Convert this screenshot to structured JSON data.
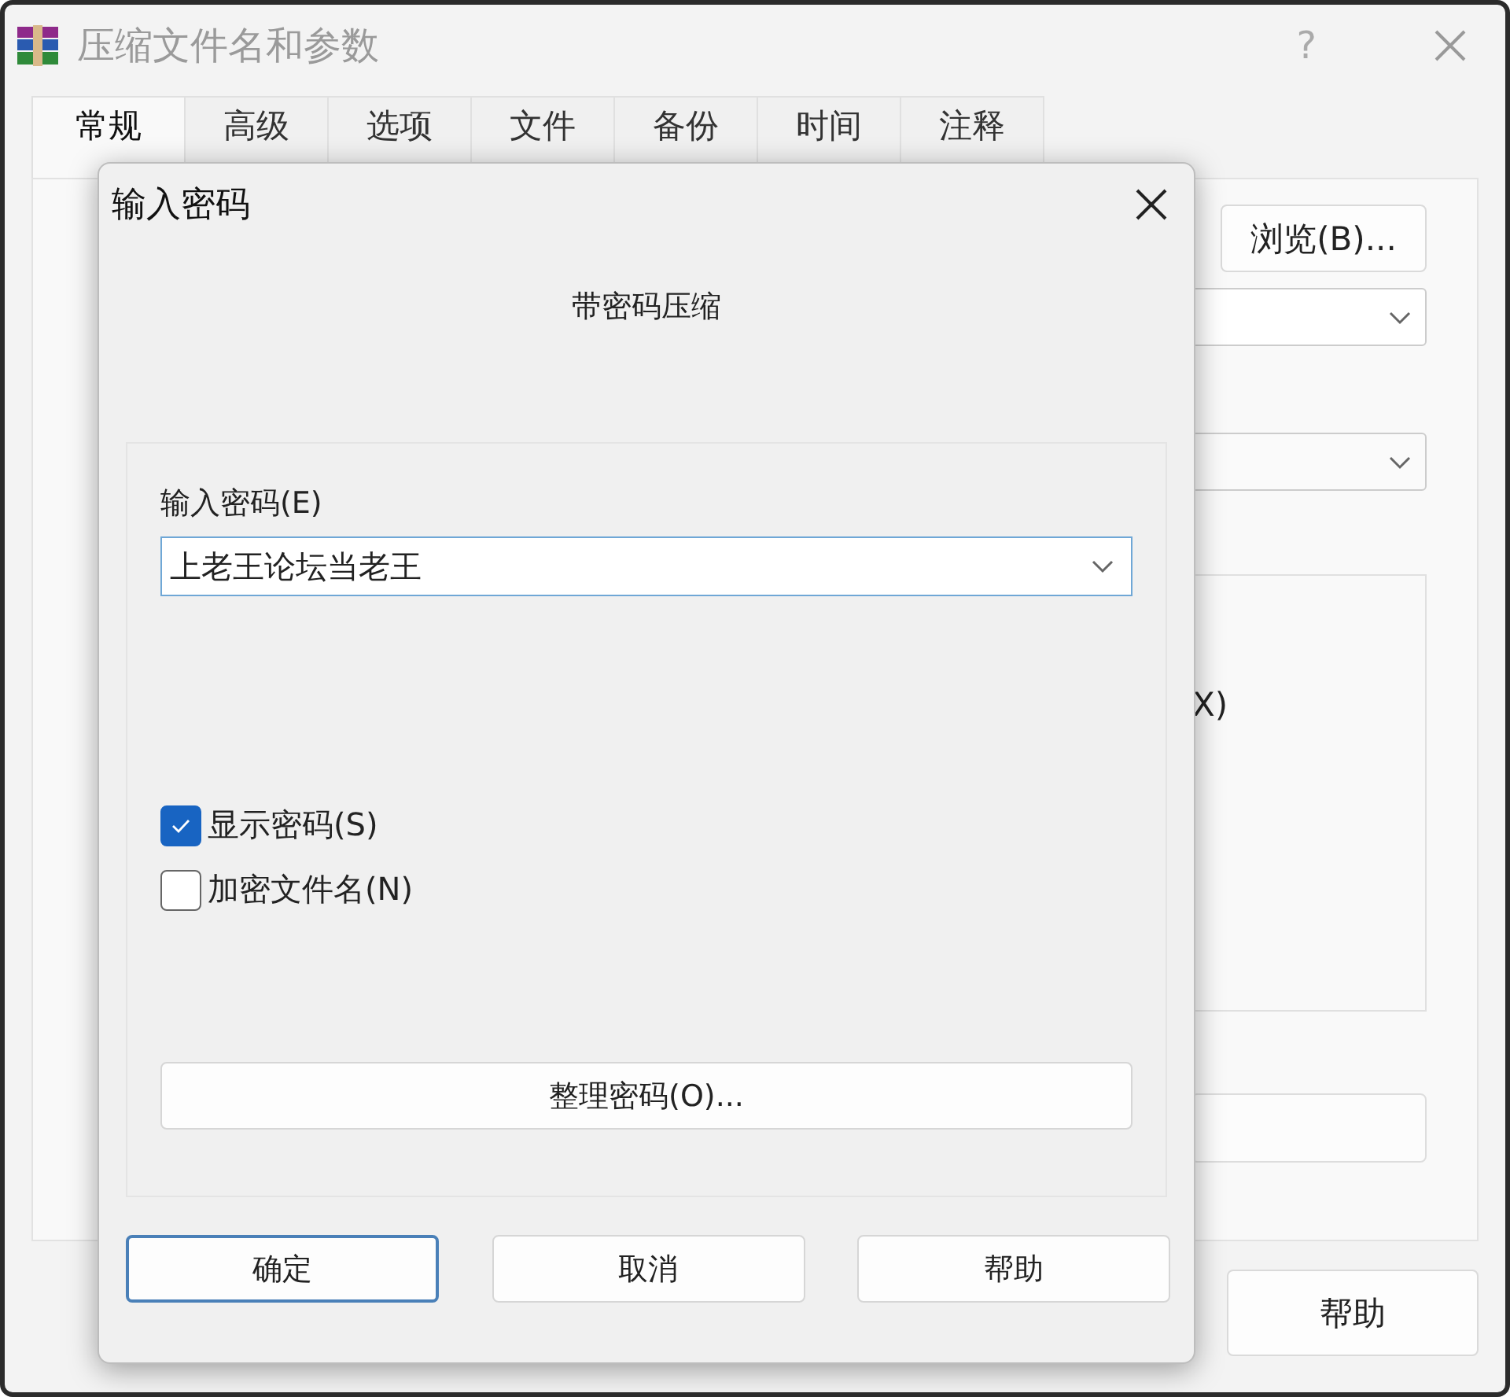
{
  "window": {
    "title": "压缩文件名和参数",
    "help_glyph": "?"
  },
  "tabs": [
    {
      "label": "常规",
      "selected": true
    },
    {
      "label": "高级",
      "selected": false
    },
    {
      "label": "选项",
      "selected": false
    },
    {
      "label": "文件",
      "selected": false
    },
    {
      "label": "备份",
      "selected": false
    },
    {
      "label": "时间",
      "selected": false
    },
    {
      "label": "注释",
      "selected": false
    }
  ],
  "browse_button": "浏览(B)...",
  "partial_text": "X)",
  "help_button": "帮助",
  "dialog": {
    "title": "输入密码",
    "subtitle": "带密码压缩",
    "password_label": "输入密码(E)",
    "password_value": "上老王论坛当老王",
    "options": [
      {
        "label": "显示密码(S)",
        "checked": true
      },
      {
        "label": "加密文件名(N)",
        "checked": false
      }
    ],
    "manage_button": "整理密码(O)...",
    "buttons": [
      {
        "label": "确定",
        "default": true
      },
      {
        "label": "取消",
        "default": false
      },
      {
        "label": "帮助",
        "default": false
      }
    ]
  }
}
